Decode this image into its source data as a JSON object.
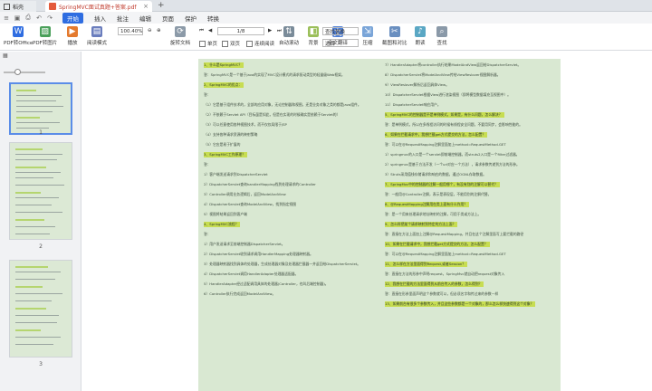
{
  "titlebar": {
    "home_tab": "稻壳",
    "doc_tab": "SpringMVC面试真题+答案.pdf",
    "new_tab": "+"
  },
  "menubar": {
    "items": [
      "开始",
      "插入",
      "批注",
      "编辑",
      "页面",
      "保护",
      "转换"
    ],
    "active": "开始"
  },
  "ribbon": {
    "pdf_to_office": "PDF转Office",
    "pdf_to_image": "PDF转图片",
    "play": "播放",
    "read_mode": "阅读模式",
    "zoom": "100.40%",
    "page": "1/8",
    "rotate_doc": "旋转文档",
    "single_page": "单页",
    "double_page": "双页",
    "continuous": "连续阅读",
    "auto_scroll": "自动滚动",
    "background": "背景",
    "fulltext_translate": "全文翻译",
    "compress": "压缩",
    "screenshot_compare": "截图和对比",
    "read": "朗读",
    "find": "查找",
    "find_replace": "查找替换",
    "select": "选择"
  },
  "thumbnails": [
    {
      "page": "1"
    },
    {
      "page": "2"
    },
    {
      "page": "3"
    }
  ],
  "document": {
    "left_column": [
      {
        "text": "1、什么是SpringMVC？",
        "hl": true
      },
      {
        "text": "答：SpringMVC是一个基于Java的实现了MVC设计模式的请求驱动类型的轻量级Web框架。",
        "hl": false
      },
      {
        "text": "2、SpringMVC的优点：",
        "hl": true
      },
      {
        "text": "答：",
        "hl": false
      },
      {
        "text": "（1）它是基于组件技术的，全部的应用对象，无论控制器和视图，还是业务对象之类的都是java组件。",
        "hl": false
      },
      {
        "text": "（2）不依赖于Servlet API（目标虽是如此，但是在实现的时候确实是依赖于Servlet的）",
        "hl": false
      },
      {
        "text": "（3）可以任意使用各种视图技术，而不仅仅局限于JSP",
        "hl": false
      },
      {
        "text": "（4）支持各种请求资源的映射策略",
        "hl": false
      },
      {
        "text": "（5）它应是易于扩展的",
        "hl": false
      },
      {
        "text": "3、SpringMVC工作原理？",
        "hl": true
      },
      {
        "text": "答：",
        "hl": false
      },
      {
        "text": "1）客户端发送请求到DispatcherServlet",
        "hl": false
      },
      {
        "text": "2）DispatcherServlet查询handlerMapping找到处理请求的Controller",
        "hl": false
      },
      {
        "text": "3）Controller调用业务逻辑后，返回ModelAndView",
        "hl": false
      },
      {
        "text": "4）DispatcherServlet查询ModelAndView，找到指定视图",
        "hl": false
      },
      {
        "text": "5）视图将结果返回到客户端",
        "hl": false
      },
      {
        "text": "4、SpringMVC流程？",
        "hl": true
      },
      {
        "text": "答：",
        "hl": false
      },
      {
        "text": "1）用户发送请求至前端控制器DispatcherServlet。",
        "hl": false
      },
      {
        "text": "2）DispatcherServlet收到请求调用HandlerMapping处理器映射器。",
        "hl": false
      },
      {
        "text": "3）处理器映射器找到具体的处理器，生成处理器对象及处理器拦截器一并返回给DispatcherServlet。",
        "hl": false
      },
      {
        "text": "4）DispatcherServlet调用HandlerAdapter处理器适配器。",
        "hl": false
      },
      {
        "text": "5）HandlerAdapter经过适配调用具体的处理器(Controller，也叫后端控制器)。",
        "hl": false
      },
      {
        "text": "6）Controller执行完成返回ModelAndView。",
        "hl": false
      }
    ],
    "right_column": [
      {
        "text": "7）HandlerAdapter将controller执行结果ModelAndView返回给DispatcherServlet。",
        "hl": false
      },
      {
        "text": "8）DispatcherServlet将ModelAndView传给ViewReslover视图解析器。",
        "hl": false
      },
      {
        "text": "9）ViewReslover解析后返回具体View。",
        "hl": false
      },
      {
        "text": "10）DispatcherServlet根据View进行渲染视图（即将模型数据填充至视图中）。",
        "hl": false
      },
      {
        "text": "11）DispatcherServlet响应用户。",
        "hl": false
      },
      {
        "text": "5、SpringMVC的控制器是不是单例模式，如果是，有什么问题，怎么解决？",
        "hl": true
      },
      {
        "text": "答：是单例模式，所以在多线程访问的时候有线程安全问题，不要用同步，会影响性能的。",
        "hl": false
      },
      {
        "text": "6、如果在拦截请求中，我想拦截get方式提交的方法，怎么配置？",
        "hl": true
      },
      {
        "text": "答：可以在@RequestMapping注解里面加上method=RequestMethod.GET",
        "hl": false
      },
      {
        "text": "1）springmvc的入口是一个servlet即前端控制器，而struts2入口是一个filter过滤器。",
        "hl": false
      },
      {
        "text": "2）springmvc是基于方法开发（一个url对应一个方法），请求参数传递到方法的形参。",
        "hl": false
      },
      {
        "text": "3）Struts采用值栈存储请求和响应的数据，通过OGNL存取数据。",
        "hl": false
      },
      {
        "text": "7、SpringMvc中的控制器的注解一般用哪个，有没有别的注解可以替代？",
        "hl": true
      },
      {
        "text": "答：一般用@Controller注解，表示是表现层，不能用别的注解代替。",
        "hl": false
      },
      {
        "text": "8、@RequestMapping注解用在类上面有什么作用？",
        "hl": true
      },
      {
        "text": "答：是一个用来处理请求地址映射的注解，可用于类或方法上。",
        "hl": false
      },
      {
        "text": "9、怎么样把某个请求映射到特定的方法上面？",
        "hl": true
      },
      {
        "text": "答：直接在方法上面加上注解@RequestMapping，并且在这个注解里面写上要拦截的路径",
        "hl": false
      },
      {
        "text": "10、如果在拦截请求中，我想拦截get方式提交的方法，怎么配置？",
        "hl": true
      },
      {
        "text": "答：可以在@RequestMapping注解里面加上method=RequestMethod.GET",
        "hl": false
      },
      {
        "text": "11、怎么样在方法里面得到Request,或者Session？",
        "hl": true
      },
      {
        "text": "答：直接在方法的形参中声明request，SpringMvc就自动把request对象传入",
        "hl": false
      },
      {
        "text": "12、我想在拦截的方法里面得到从前台传入的参数，怎么得到？",
        "hl": true
      },
      {
        "text": "答：直接在形参里面声明这个参数就可以，但必须名字和传过来的参数一样",
        "hl": false
      },
      {
        "text": "13、如果前台有很多个参数传入，并且这些参数都是一个对象的，那么怎么样快速得到这个对象？",
        "hl": true
      }
    ]
  }
}
